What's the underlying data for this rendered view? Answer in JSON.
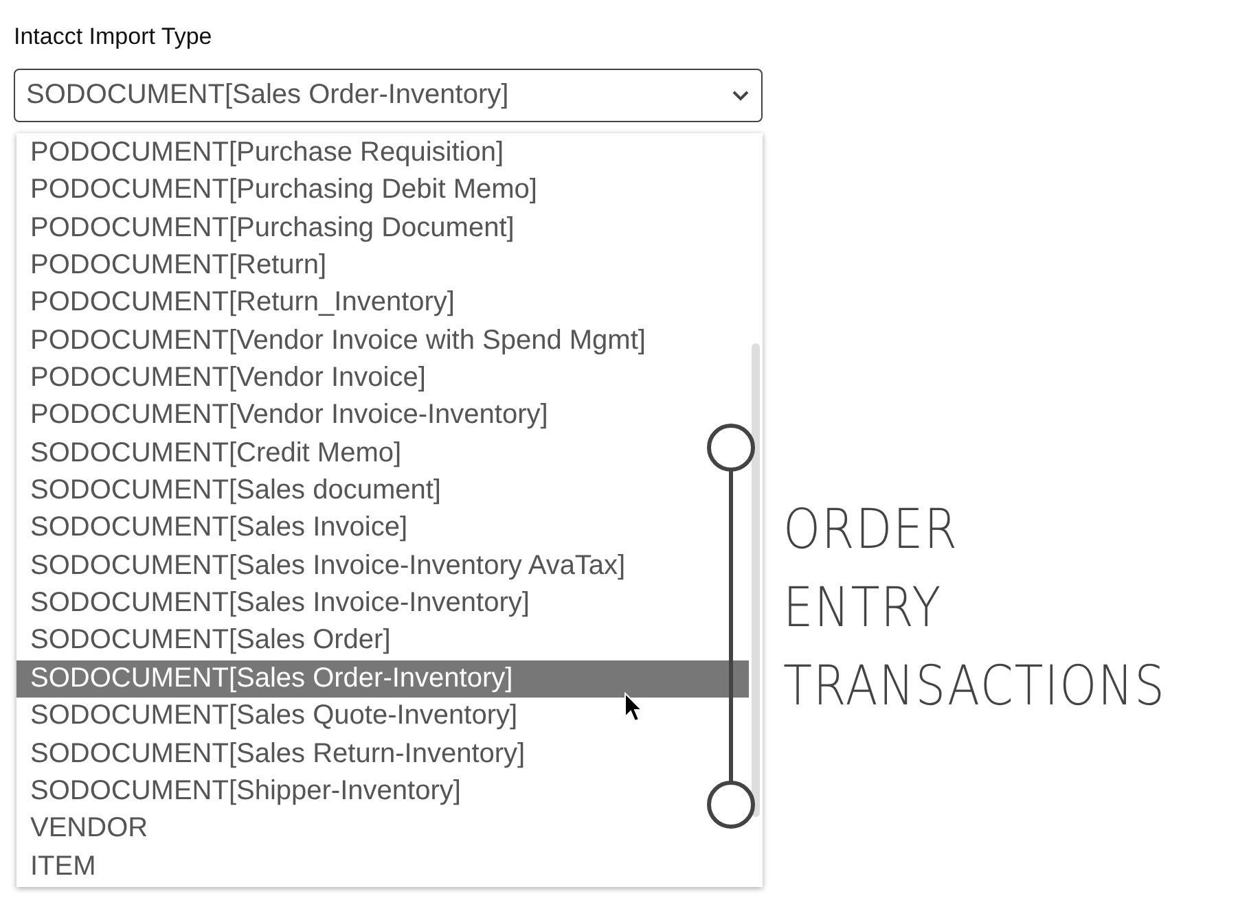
{
  "field": {
    "label": "Intacct Import Type",
    "value": "SODOCUMENT[Sales Order-Inventory]"
  },
  "options": [
    {
      "label": "PODOCUMENT[Purchase Requisition]",
      "selected": false
    },
    {
      "label": "PODOCUMENT[Purchasing Debit Memo]",
      "selected": false
    },
    {
      "label": "PODOCUMENT[Purchasing Document]",
      "selected": false
    },
    {
      "label": "PODOCUMENT[Return]",
      "selected": false
    },
    {
      "label": "PODOCUMENT[Return_Inventory]",
      "selected": false
    },
    {
      "label": "PODOCUMENT[Vendor Invoice with Spend Mgmt]",
      "selected": false
    },
    {
      "label": "PODOCUMENT[Vendor Invoice]",
      "selected": false
    },
    {
      "label": "PODOCUMENT[Vendor Invoice-Inventory]",
      "selected": false
    },
    {
      "label": "SODOCUMENT[Credit Memo]",
      "selected": false
    },
    {
      "label": "SODOCUMENT[Sales document]",
      "selected": false
    },
    {
      "label": "SODOCUMENT[Sales Invoice]",
      "selected": false
    },
    {
      "label": "SODOCUMENT[Sales Invoice-Inventory AvaTax]",
      "selected": false
    },
    {
      "label": "SODOCUMENT[Sales Invoice-Inventory]",
      "selected": false
    },
    {
      "label": "SODOCUMENT[Sales Order]",
      "selected": false
    },
    {
      "label": "SODOCUMENT[Sales Order-Inventory]",
      "selected": true
    },
    {
      "label": "SODOCUMENT[Sales Quote-Inventory]",
      "selected": false
    },
    {
      "label": "SODOCUMENT[Sales Return-Inventory]",
      "selected": false
    },
    {
      "label": "SODOCUMENT[Shipper-Inventory]",
      "selected": false
    },
    {
      "label": "VENDOR",
      "selected": false
    },
    {
      "label": "ITEM",
      "selected": false
    }
  ],
  "annotation": {
    "lines": [
      "ORDER",
      "ENTRY",
      "TRANSACTIONS"
    ]
  }
}
